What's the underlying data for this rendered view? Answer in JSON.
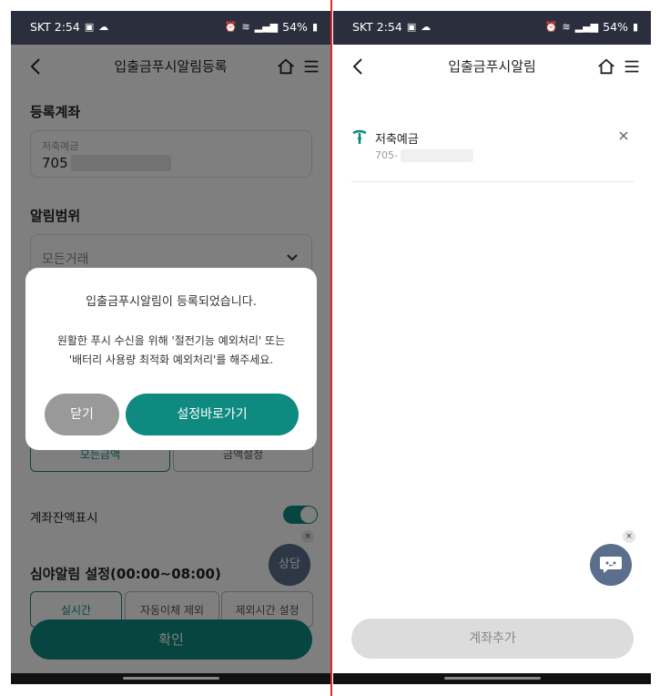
{
  "left": {
    "status": {
      "carrier_time": "SKT 2:54",
      "battery": "54%"
    },
    "appbar": {
      "title": "입출금푸시알림등록"
    },
    "registered_account": {
      "section_title": "등록계좌",
      "field_label": "저축예금",
      "account_prefix": "705"
    },
    "alert_range": {
      "section_title": "알림범위",
      "select_value": "모든거래"
    },
    "amount_buttons": [
      "모든금액",
      "금액설정"
    ],
    "balance_row": {
      "label": "계좌잔액표시"
    },
    "night": {
      "section_title": "심야알림 설정(00:00~08:00)",
      "options": [
        "실시간",
        "자동이체 제외",
        "제외시간 설정"
      ]
    },
    "chat_label": "상담",
    "fab_close": "×",
    "confirm_label": "확인",
    "dialog": {
      "message": "입출금푸시알림이 등록되었습니다.",
      "detail_line1": "원활한 푸시 수신을 위해 '절전기능 예외처리' 또는",
      "detail_line2": "'배터리 사용량 최적화 예외처리'를 해주세요.",
      "close_label": "닫기",
      "go_label": "설정바로가기"
    }
  },
  "right": {
    "status": {
      "carrier_time": "SKT 2:54",
      "battery": "54%"
    },
    "appbar": {
      "title": "입출금푸시알림"
    },
    "account": {
      "name": "저축예금",
      "number_prefix": "705-"
    },
    "fab_close": "×",
    "add_label": "계좌추가"
  },
  "colors": {
    "teal": "#0e8a80",
    "statusbar": "#2b2f3d",
    "divider": "#e0262f"
  }
}
